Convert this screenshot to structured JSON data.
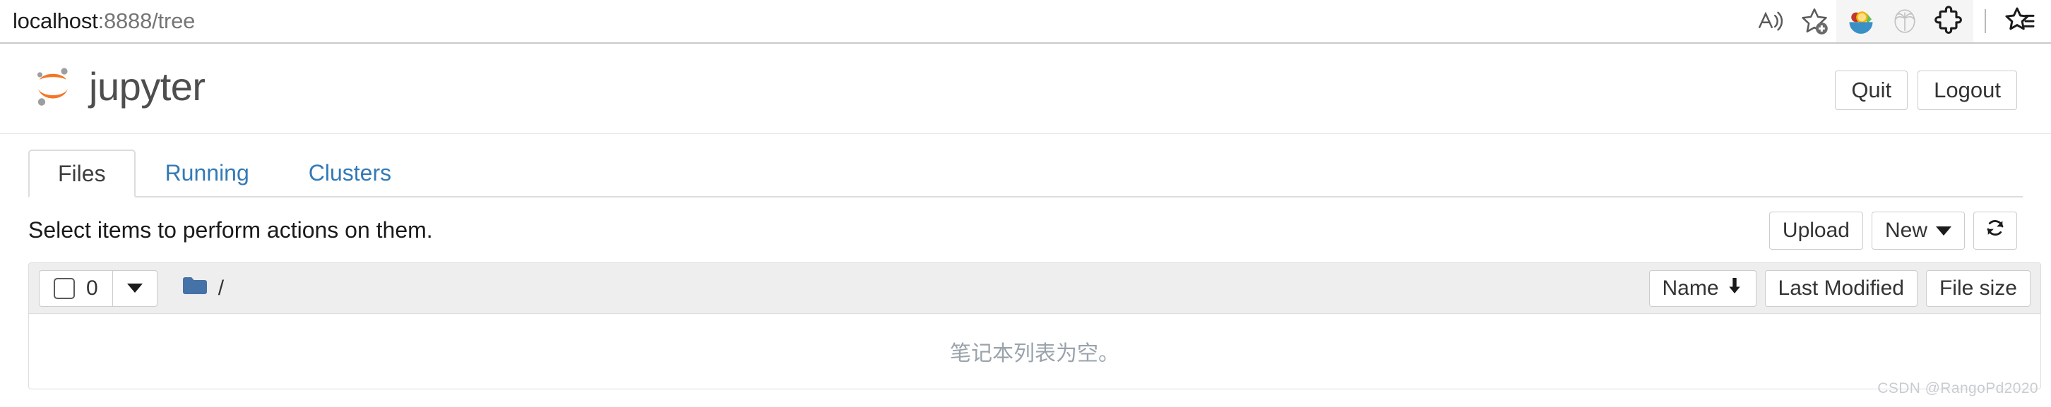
{
  "browser": {
    "address": {
      "host": "localhost",
      "path": ":8888/tree"
    },
    "toolbar_icons": [
      {
        "name": "read-aloud-icon",
        "label": "Read aloud"
      },
      {
        "name": "add-favorite-icon",
        "label": "Add this page to favorites"
      },
      {
        "name": "fruit-bowl-extension-icon",
        "label": "Extension"
      },
      {
        "name": "palm-tree-extension-icon",
        "label": "Extension"
      },
      {
        "name": "extensions-puzzle-icon",
        "label": "Extensions"
      },
      {
        "name": "favorites-star-list-icon",
        "label": "Favorites"
      }
    ]
  },
  "header": {
    "brand": "jupyter",
    "logo_colors": {
      "arc": "#f37726",
      "dot": "#9e9e9e"
    },
    "quit_label": "Quit",
    "logout_label": "Logout"
  },
  "tabs": [
    {
      "label": "Files",
      "active": true
    },
    {
      "label": "Running",
      "active": false
    },
    {
      "label": "Clusters",
      "active": false
    }
  ],
  "actions": {
    "select_hint": "Select items to perform actions on them.",
    "upload_label": "Upload",
    "new_label": "New",
    "refresh_label": "Refresh notebook list"
  },
  "list": {
    "selected_count": "0",
    "breadcrumb_root": "/",
    "sort_name": "Name",
    "sort_name_direction": "↓",
    "sort_last_modified": "Last Modified",
    "sort_file_size": "File size",
    "empty_message": "笔记本列表为空。"
  },
  "watermark": "CSDN @RangoPd2020",
  "colors": {
    "jupyter_orange": "#f37726",
    "link_blue": "#337ab7",
    "folder_blue": "#4572a7",
    "toolbar_gray": "#eeeeee",
    "border_gray": "#dddddd"
  }
}
